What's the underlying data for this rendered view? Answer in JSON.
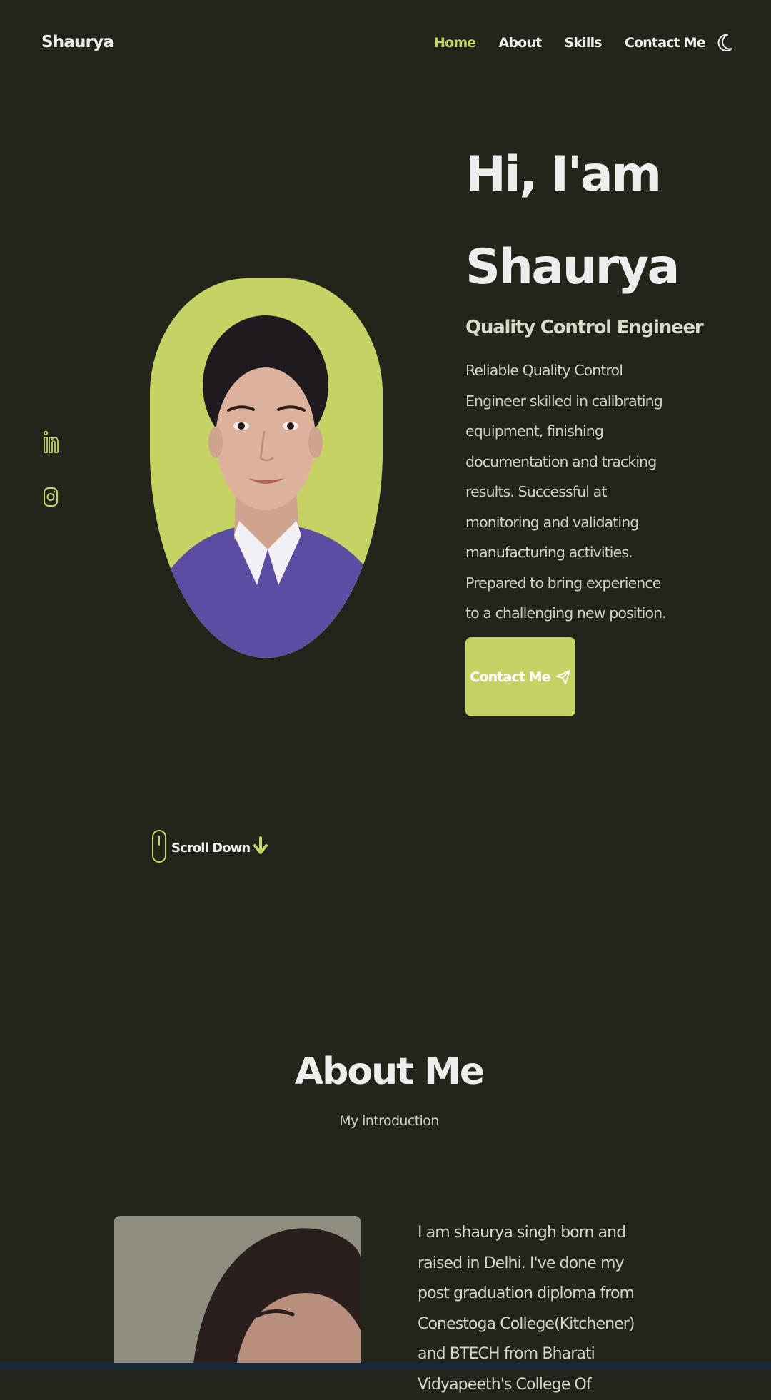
{
  "header": {
    "logo": "Shaurya",
    "nav": {
      "home": "Home",
      "about": "About",
      "skills": "Skills",
      "contact": "Contact Me"
    },
    "theme_icon": "moon-icon"
  },
  "socials": [
    {
      "icon": "linkedin-icon"
    },
    {
      "icon": "instagram-icon"
    }
  ],
  "hero": {
    "title_line1": "Hi, I'am",
    "title_line2": "Shaurya",
    "subtitle": "Quality Control Engineer",
    "description": "Reliable Quality Control Engineer skilled in calibrating equipment, finishing documentation and tracking results. Successful at monitoring and validating manufacturing activities. Prepared to bring experience to a challenging new position.",
    "button_label": "Contact Me",
    "button_icon": "send-icon"
  },
  "scroll": {
    "label": "Scroll Down",
    "icons": [
      "mouse-icon",
      "arrow-down-icon"
    ]
  },
  "about": {
    "title": "About Me",
    "subtitle": "My introduction",
    "text": "I am shaurya singh born and raised in Delhi. I've done my post graduation diploma from Conestoga College(Kitchener) and BTECH from Bharati Vidyapeeth's College Of"
  },
  "colors": {
    "background": "#23251a",
    "accent": "#c6d263",
    "text": "#ededed"
  }
}
